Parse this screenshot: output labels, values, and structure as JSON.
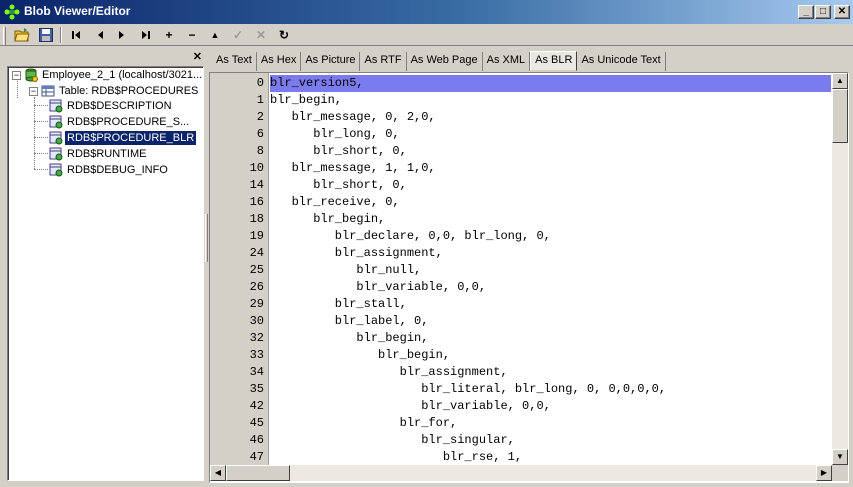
{
  "window": {
    "title": "Blob Viewer/Editor",
    "min_label": "_",
    "max_label": "□",
    "close_label": "✕"
  },
  "toolbar": {
    "open": "📂",
    "save": "💾",
    "first": "|◀",
    "prev": "◀",
    "next": "▶",
    "last": "▶|",
    "add": "+",
    "delete": "−",
    "up": "▲",
    "post": "✓",
    "cancel": "✕",
    "refresh": "↻"
  },
  "left_panel": {
    "close_label": "✕",
    "tree": {
      "root": "Employee_2_1 (localhost/3021...",
      "table": "Table: RDB$PROCEDURES",
      "fields": [
        "RDB$DESCRIPTION",
        "RDB$PROCEDURE_S...",
        "RDB$PROCEDURE_BLR",
        "RDB$RUNTIME",
        "RDB$DEBUG_INFO"
      ]
    }
  },
  "tabs": [
    "As Text",
    "As Hex",
    "As Picture",
    "As RTF",
    "As Web Page",
    "As XML",
    "As BLR",
    "As Unicode Text"
  ],
  "active_tab": "As BLR",
  "code": [
    {
      "n": "0",
      "text": "blr_version5,"
    },
    {
      "n": "1",
      "text": "blr_begin,"
    },
    {
      "n": "2",
      "text": "   blr_message, 0, 2,0,"
    },
    {
      "n": "6",
      "text": "      blr_long, 0,"
    },
    {
      "n": "8",
      "text": "      blr_short, 0,"
    },
    {
      "n": "10",
      "text": "   blr_message, 1, 1,0,"
    },
    {
      "n": "14",
      "text": "      blr_short, 0,"
    },
    {
      "n": "16",
      "text": "   blr_receive, 0,"
    },
    {
      "n": "18",
      "text": "      blr_begin,"
    },
    {
      "n": "19",
      "text": "         blr_declare, 0,0, blr_long, 0,"
    },
    {
      "n": "24",
      "text": "         blr_assignment,"
    },
    {
      "n": "25",
      "text": "            blr_null,"
    },
    {
      "n": "26",
      "text": "            blr_variable, 0,0,"
    },
    {
      "n": "29",
      "text": "         blr_stall,"
    },
    {
      "n": "30",
      "text": "         blr_label, 0,"
    },
    {
      "n": "32",
      "text": "            blr_begin,"
    },
    {
      "n": "33",
      "text": "               blr_begin,"
    },
    {
      "n": "34",
      "text": "                  blr_assignment,"
    },
    {
      "n": "35",
      "text": "                     blr_literal, blr_long, 0, 0,0,0,0,"
    },
    {
      "n": "42",
      "text": "                     blr_variable, 0,0,"
    },
    {
      "n": "45",
      "text": "                  blr_for,"
    },
    {
      "n": "46",
      "text": "                     blr_singular,"
    },
    {
      "n": "47",
      "text": "                        blr_rse, 1,"
    }
  ],
  "scroll": {
    "up": "▲",
    "down": "▼",
    "left": "◀",
    "right": "▶"
  },
  "colors": {
    "highlight": "#7b7bf0",
    "selection": "#0a246a"
  }
}
